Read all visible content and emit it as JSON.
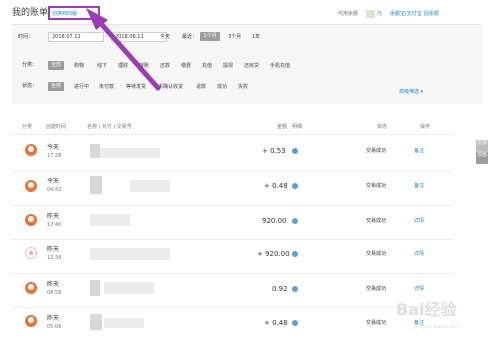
{
  "header": {
    "title": "我的账单",
    "switch_link": "切换到旧版",
    "balance_label": "可用余额",
    "balance_unit": "元",
    "sub_links": [
      "余额宝|支付宝",
      "回余额"
    ]
  },
  "filters": {
    "time_label": "时间：",
    "date_from": "2018.07.11",
    "date_to": "2018.08.11",
    "range_label": "最近：",
    "quick_ranges": [
      "今天",
      "1个月",
      "3个月",
      "1年"
    ],
    "active_range": "1个月",
    "category_label": "分类：",
    "categories": [
      "全部",
      "购物",
      "线下",
      "理财",
      "转账",
      "还款",
      "缴费",
      "充值",
      "提现",
      "还房贷",
      "手机充值"
    ],
    "status_label": "状态：",
    "statuses": [
      "全部",
      "进行中",
      "未付款",
      "等待发货",
      "未确认收货",
      "退款",
      "成功",
      "失败"
    ],
    "advanced": "高级筛选"
  },
  "table": {
    "headers": [
      "分类",
      "创建时间",
      "名称 | 对方 | 交易号",
      "金额",
      "明细",
      "状态",
      "操作"
    ],
    "rows": [
      {
        "day": "今天",
        "time": "17:28",
        "amount": "+ 0.53",
        "status": "交易成功",
        "action": "备注"
      },
      {
        "day": "今天",
        "time": "04:42",
        "amount": "+ 0.48",
        "status": "交易成功",
        "action": "备注"
      },
      {
        "day": "昨天",
        "time": "12:40",
        "amount": "920.00",
        "status": "交易成功",
        "action": "详情"
      },
      {
        "day": "昨天",
        "time": "12:39",
        "amount": "+ 920.00",
        "status": "交易成功",
        "action": "详情"
      },
      {
        "day": "昨天",
        "time": "08:58",
        "amount": "0.92",
        "status": "交易成功",
        "action": "详情"
      },
      {
        "day": "昨天",
        "time": "05:06",
        "amount": "+ 0.48",
        "status": "交易成功",
        "action": "备注"
      }
    ]
  },
  "side": {
    "feedback": "反馈",
    "top": "顶部"
  },
  "annotation": {
    "arrow_color": "#9b3bb5"
  },
  "watermark": {
    "text": "Bai经验",
    "subtext": "jingyan.baidu.com"
  }
}
